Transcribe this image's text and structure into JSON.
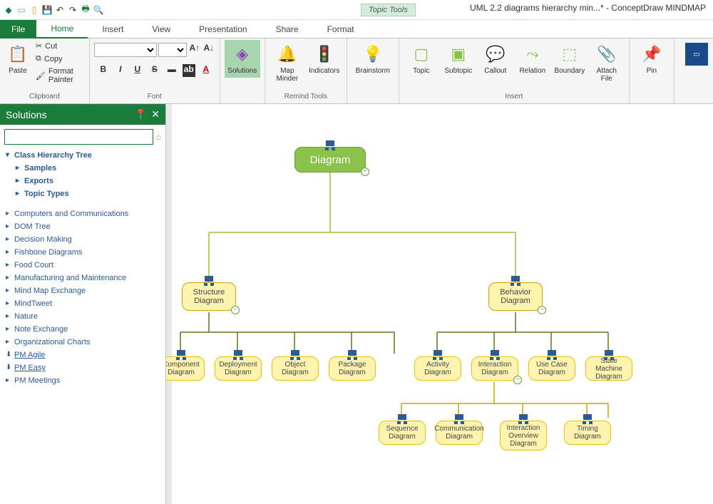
{
  "app": {
    "title": "UML 2.2 diagrams hierarchy min...* - ConceptDraw MINDMAP",
    "contextual_tab": "Topic Tools"
  },
  "tabs": {
    "file": "File",
    "items": [
      "Home",
      "Insert",
      "View",
      "Presentation",
      "Share",
      "Format"
    ],
    "active": "Home"
  },
  "ribbon": {
    "clipboard": {
      "paste": "Paste",
      "cut": "Cut",
      "copy": "Copy",
      "format_painter": "Format Painter",
      "label": "Clipboard"
    },
    "font": {
      "label": "Font"
    },
    "solutions": "Solutions",
    "remind": {
      "map_minder": "Map\nMinder",
      "indicators": "Indicators",
      "label": "Remind Tools"
    },
    "brainstorm": "Brainstorm",
    "insert": {
      "topic": "Topic",
      "subtopic": "Subtopic",
      "callout": "Callout",
      "relation": "Relation",
      "boundary": "Boundary",
      "attach": "Attach\nFile",
      "label": "Insert"
    },
    "pin": "Pin"
  },
  "panel": {
    "title": "Solutions",
    "root": "Class Hierarchy Tree",
    "sub": [
      "Samples",
      "Exports",
      "Topic Types"
    ],
    "items": [
      "Computers and Communications",
      "DOM Tree",
      "Decision Making",
      "Fishbone Diagrams",
      "Food Court",
      "Manufacturing and Maintenance",
      "Mind Map Exchange",
      "MindTweet",
      "Nature",
      "Note Exchange",
      "Organizational Charts"
    ],
    "dl": [
      "PM Agile",
      "PM Easy",
      "PM Meetings"
    ]
  },
  "diagram": {
    "root": "Diagram",
    "l2": [
      "Structure Diagram",
      "Behavior Diagram"
    ],
    "structure_children": [
      "Component Diagram",
      "Deployment Diagram",
      "Object Diagram",
      "Package Diagram"
    ],
    "behavior_children": [
      "Activity Diagram",
      "Interaction Diagram",
      "Use Case Diagram",
      "State Machine Diagram"
    ],
    "interaction_children": [
      "Sequence Diagram",
      "Communication Diagram",
      "Interaction Overview Diagram",
      "Timing Diagram"
    ]
  }
}
